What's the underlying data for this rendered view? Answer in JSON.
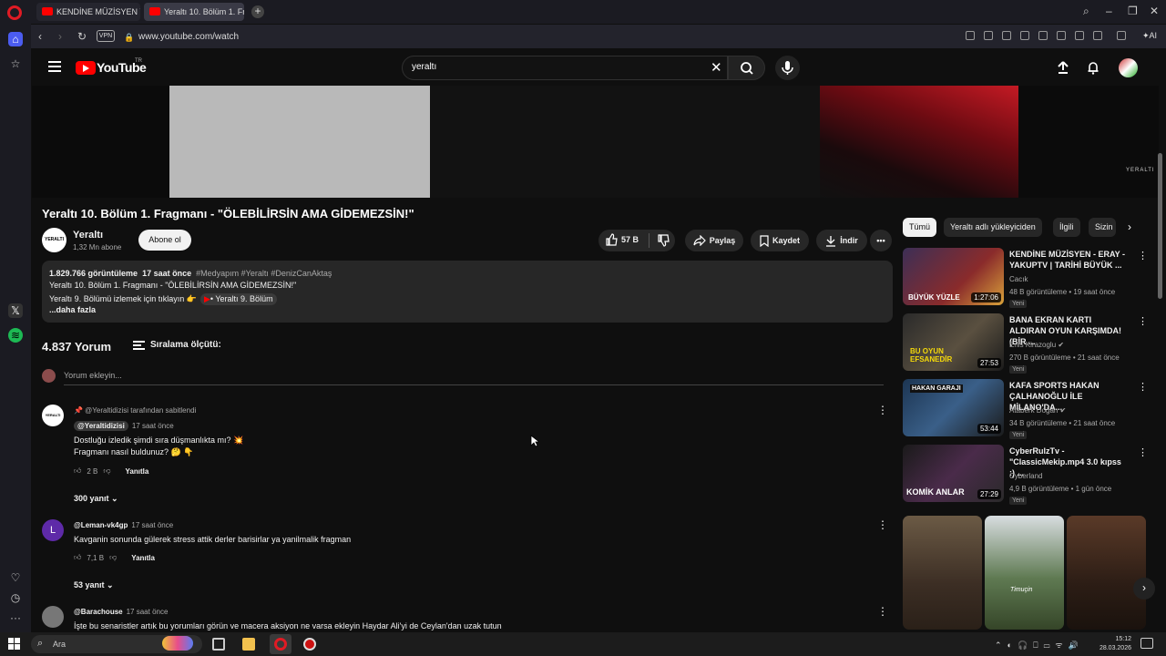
{
  "browser": {
    "tabs": [
      {
        "label": "KENDİNE MÜZİSYEN YÜZ"
      },
      {
        "label": "Yeraltı 10. Bölüm 1. Fragm"
      }
    ],
    "url": "www.youtube.com/watch",
    "vpn_label": "VPN",
    "ai_label": "AI"
  },
  "header": {
    "logo_text": "YouTube",
    "logo_region": "TR",
    "search_value": "yeraltı"
  },
  "video": {
    "watermark": "YERALTI",
    "title": "Yeraltı 10. Bölüm 1. Fragmanı - \"ÖLEBİLİRSİN AMA GİDEMEZSİN!\"",
    "channel_avatar_text": "YERALTI",
    "channel_name": "Yeraltı",
    "subscribers": "1,32 Mn abone",
    "subscribe_label": "Abone ol",
    "likes": "57 B",
    "share_label": "Paylaş",
    "save_label": "Kaydet",
    "download_label": "İndir"
  },
  "description": {
    "views": "1.829.766 görüntüleme",
    "time": "17 saat önce",
    "tags": "#Medyapım #Yeraltı #DenizCanAktaş",
    "line1": "Yeraltı 10. Bölüm 1. Fragmanı - \"ÖLEBİLİRSİN AMA GİDEMEZSİN!\"",
    "line2": "Yeraltı 9. Bölümü izlemek için tıklayın 👉",
    "chip": "• Yeraltı 9. Bölüm",
    "more": "...daha fazla"
  },
  "comments": {
    "count_label": "4.837 Yorum",
    "sort_label": "Sıralama ölçütü:",
    "add_placeholder": "Yorum ekleyin...",
    "reply_label": "Yanıtla",
    "items": [
      {
        "pinned": "📌 @Yeraltidizisi tarafından sabitlendi",
        "author": "@Yeraltidizisi",
        "time": "17 saat önce",
        "avatar": "YERALTI",
        "text1": "Dostluğu izledik şimdi sıra düşmanlıkta mı? 💥",
        "text2": "Fragmanı nasıl buldunuz? 🤔 👇",
        "likes": "2 B",
        "replies": "300 yanıt"
      },
      {
        "author": "@Leman-vk4gp",
        "time": "17 saat önce",
        "avatar": "L",
        "text1": "Kavganin sonunda gülerek stress attik derler barisirlar ya yanilmalik fragman",
        "likes": "7,1 B",
        "replies": "53 yanıt"
      },
      {
        "author": "@Barachouse",
        "time": "17 saat önce",
        "text1": "İşte bu senaristler artık bu yorumları görün ve macera aksiyon ne varsa ekleyin Haydar Ali'yi de Ceylan'dan uzak tutun"
      }
    ]
  },
  "related": {
    "chips": [
      "Tümü",
      "Yeraltı adlı yükleyiciden",
      "İlgili",
      "Sizin"
    ],
    "videos": [
      {
        "title": "KENDİNE MÜZİSYEN - ERAY - YAKUPTV | TARİHİ BÜYÜK ...",
        "channel": "Cacık",
        "meta": "48 B görüntüleme • 19 saat önce",
        "badge": "Yeni",
        "duration": "1:27:06",
        "thumb_text": "BÜYÜK YÜZLE"
      },
      {
        "title": "BANA EKRAN KARTI ALDIRAN OYUN KARŞIMDA! (BİR ...",
        "channel": "Enis Kirazoglu ✔",
        "meta": "270 B görüntüleme • 21 saat önce",
        "badge": "Yeni",
        "duration": "27:53",
        "thumb_text": "BU OYUN EFSANEDİR"
      },
      {
        "title": "KAFA SPORTS HAKAN ÇALHANOĞLU İLE MİLANO'DA...",
        "channel": "Ataberk Doğan ✔",
        "meta": "34 B görüntüleme • 21 saat önce",
        "badge": "Yeni",
        "duration": "53:44",
        "thumb_text": "HAKAN GARAJI"
      },
      {
        "title": "CyberRulzTv - \"ClassicMekip.mp4 3.0 kıpss :) ...",
        "channel": "Cyberland",
        "meta": "4,9 B görüntüleme • 1 gün önce",
        "badge": "Yeni",
        "duration": "27:29",
        "thumb_text": "KOMİK ANLAR"
      }
    ],
    "shorts_caption": "Timuçin"
  },
  "taskbar": {
    "search_label": "Ara",
    "time": "15:12",
    "date": "28.03.2026"
  }
}
